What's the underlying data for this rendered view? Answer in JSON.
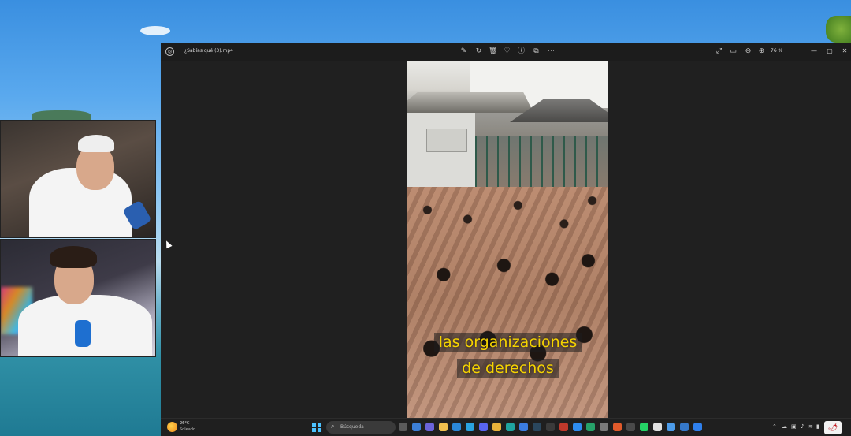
{
  "photos_window": {
    "file_title": "¿Sabías qué (3).mp4",
    "zoom_level": "76 %",
    "toolbar_icons": [
      "edit-icon",
      "rotate-icon",
      "delete-icon",
      "favorite-icon",
      "info-icon",
      "share-icon",
      "more-icon"
    ],
    "right_icons": [
      "fullscreen-icon",
      "slideshow-icon",
      "zoom-out-icon",
      "zoom-in-icon"
    ],
    "window_controls": {
      "minimize": "—",
      "maximize": "▢",
      "close": "✕"
    }
  },
  "video_caption": {
    "line1": "las organizaciones",
    "line2": "de derechos",
    "color": "#f5d300"
  },
  "taskbar": {
    "weather_temp": "26°C",
    "weather_desc": "Soleado",
    "search_placeholder": "Búsqueda",
    "search_icon": "search-icon",
    "app_icons": [
      {
        "name": "task-view-icon",
        "color": "#5a5a5a"
      },
      {
        "name": "widgets-icon",
        "color": "#3c7fd6"
      },
      {
        "name": "chat-icon",
        "color": "#6b63d9"
      },
      {
        "name": "file-explorer-icon",
        "color": "#f2c14e"
      },
      {
        "name": "mail-icon",
        "color": "#2b88d8"
      },
      {
        "name": "telegram-icon",
        "color": "#2aa3e0"
      },
      {
        "name": "discord-icon",
        "color": "#5865f2"
      },
      {
        "name": "chrome-icon",
        "color": "#e9b23a"
      },
      {
        "name": "edge-icon",
        "color": "#1fa3a0"
      },
      {
        "name": "store-icon",
        "color": "#3b7ce0"
      },
      {
        "name": "steam-icon",
        "color": "#2a475e"
      },
      {
        "name": "obs-icon",
        "color": "#3a3a3a"
      },
      {
        "name": "davinci-icon",
        "color": "#c0392b"
      },
      {
        "name": "photos-icon",
        "color": "#2d8cf0"
      },
      {
        "name": "game-icon",
        "color": "#26a269"
      },
      {
        "name": "settings-icon",
        "color": "#7a7a7a"
      },
      {
        "name": "media-player-icon",
        "color": "#e05a2b"
      },
      {
        "name": "terminal-icon",
        "color": "#4a4a4a"
      },
      {
        "name": "whatsapp-icon",
        "color": "#25d366"
      },
      {
        "name": "capcut-icon",
        "color": "#e0e0e0"
      },
      {
        "name": "paint-icon",
        "color": "#4c9be8"
      },
      {
        "name": "snipping-icon",
        "color": "#3578c9"
      },
      {
        "name": "vscode-icon",
        "color": "#2f80ed"
      }
    ],
    "tray_icons": [
      "chevron-up-icon",
      "cloud-icon",
      "network-icon",
      "volume-icon",
      "wifi-icon",
      "battery-icon"
    ],
    "notification_icon": "chili-pepper-icon"
  }
}
